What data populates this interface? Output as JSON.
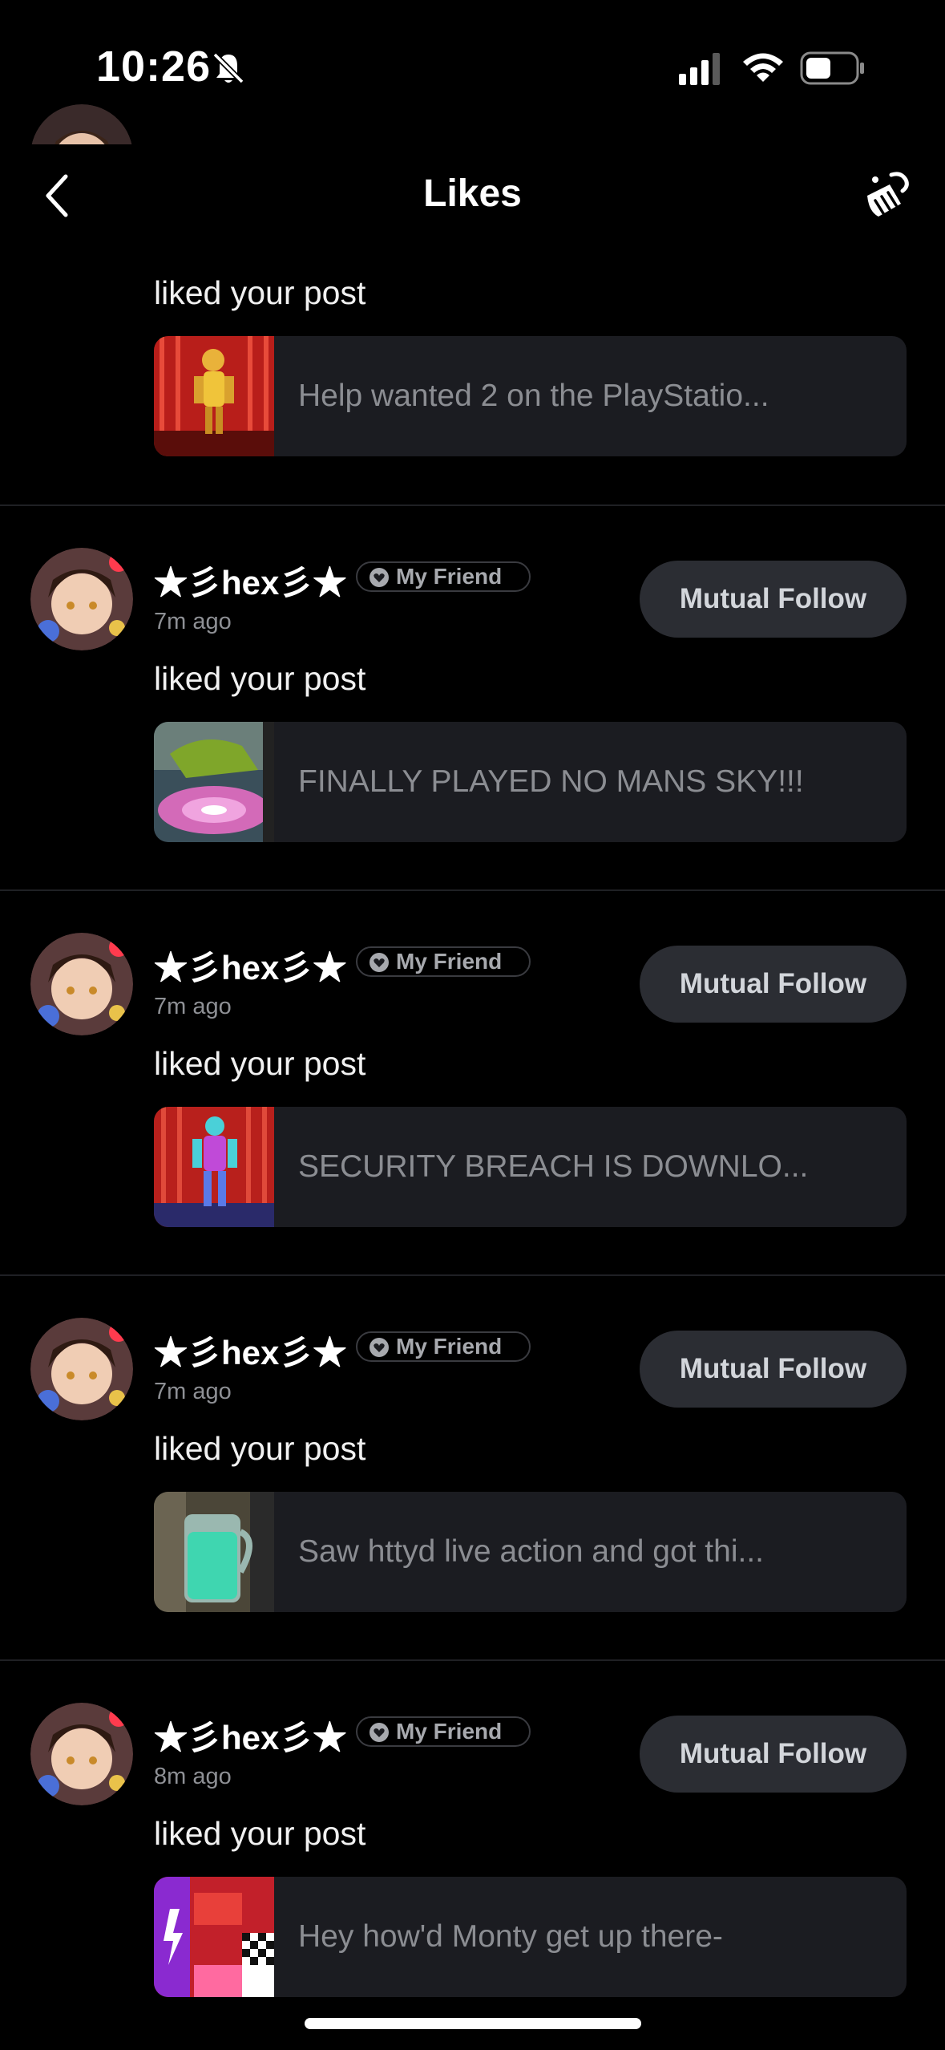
{
  "status_bar": {
    "time": "10:26"
  },
  "nav": {
    "title": "Likes"
  },
  "partial_item": {
    "action": "liked your post",
    "post_text": "Help wanted 2 on the PlayStatio..."
  },
  "items": [
    {
      "username": "★彡hex彡★",
      "badge": "My Friend",
      "time_ago": "7m ago",
      "follow_label": "Mutual Follow",
      "action": "liked your post",
      "post_text": "FINALLY PLAYED NO MANS SKY!!!"
    },
    {
      "username": "★彡hex彡★",
      "badge": "My Friend",
      "time_ago": "7m ago",
      "follow_label": "Mutual Follow",
      "action": "liked your post",
      "post_text": "SECURITY BREACH IS DOWNLO..."
    },
    {
      "username": "★彡hex彡★",
      "badge": "My Friend",
      "time_ago": "7m ago",
      "follow_label": "Mutual Follow",
      "action": "liked your post",
      "post_text": "Saw httyd live action and got thi..."
    },
    {
      "username": "★彡hex彡★",
      "badge": "My Friend",
      "time_ago": "8m ago",
      "follow_label": "Mutual Follow",
      "action": "liked your post",
      "post_text": "Hey how'd Monty get up there-"
    }
  ],
  "icons": {
    "back": "chevron-left-icon",
    "clean": "broom-icon",
    "silent": "bell-slash-icon",
    "signal": "cellular-signal-icon",
    "wifi": "wifi-icon",
    "battery": "battery-icon",
    "badge": "friend-heart-icon"
  }
}
